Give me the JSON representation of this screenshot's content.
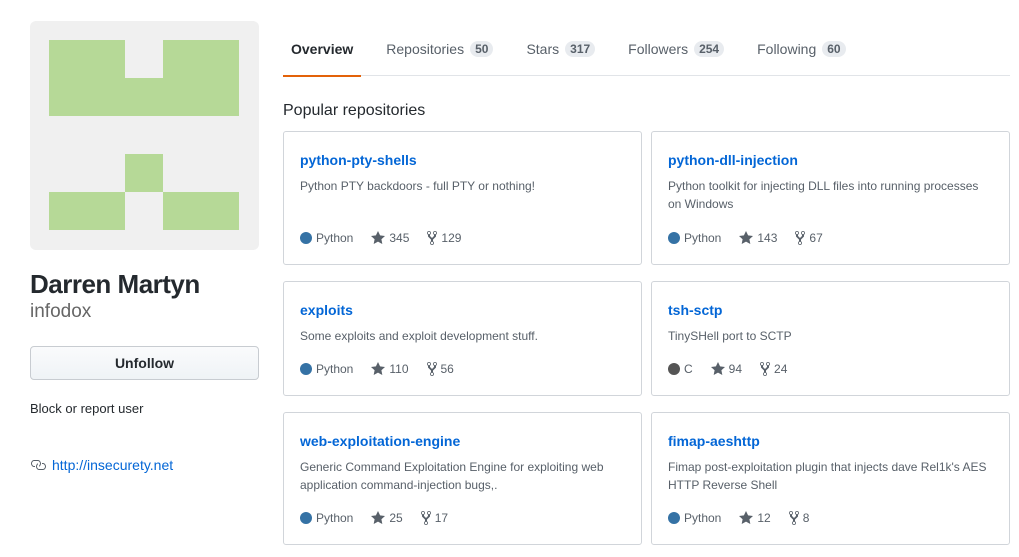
{
  "profile": {
    "fullname": "Darren Martyn",
    "username": "infodox",
    "unfollow_label": "Unfollow",
    "block_label": "Block or report user",
    "website": "http://insecurety.net",
    "avatar_color": "#b6d997"
  },
  "nav": {
    "tabs": [
      {
        "label": "Overview",
        "count": ""
      },
      {
        "label": "Repositories",
        "count": "50"
      },
      {
        "label": "Stars",
        "count": "317"
      },
      {
        "label": "Followers",
        "count": "254"
      },
      {
        "label": "Following",
        "count": "60"
      }
    ],
    "accent_color": "#e36209"
  },
  "main": {
    "section_title": "Popular repositories",
    "repos": [
      {
        "name": "python-pty-shells",
        "desc": "Python PTY backdoors - full PTY or nothing!",
        "lang": "Python",
        "lang_color": "#3572A5",
        "stars": "345",
        "forks": "129"
      },
      {
        "name": "python-dll-injection",
        "desc": "Python toolkit for injecting DLL files into running processes on Windows",
        "lang": "Python",
        "lang_color": "#3572A5",
        "stars": "143",
        "forks": "67"
      },
      {
        "name": "exploits",
        "desc": "Some exploits and exploit development stuff.",
        "lang": "Python",
        "lang_color": "#3572A5",
        "stars": "110",
        "forks": "56"
      },
      {
        "name": "tsh-sctp",
        "desc": "TinySHell port to SCTP",
        "lang": "C",
        "lang_color": "#555555",
        "stars": "94",
        "forks": "24"
      },
      {
        "name": "web-exploitation-engine",
        "desc": "Generic Command Exploitation Engine for exploiting web application command-injection bugs,.",
        "lang": "Python",
        "lang_color": "#3572A5",
        "stars": "25",
        "forks": "17"
      },
      {
        "name": "fimap-aeshttp",
        "desc": "Fimap post-exploitation plugin that injects dave Rel1k's AES HTTP Reverse Shell",
        "lang": "Python",
        "lang_color": "#3572A5",
        "stars": "12",
        "forks": "8"
      }
    ]
  }
}
